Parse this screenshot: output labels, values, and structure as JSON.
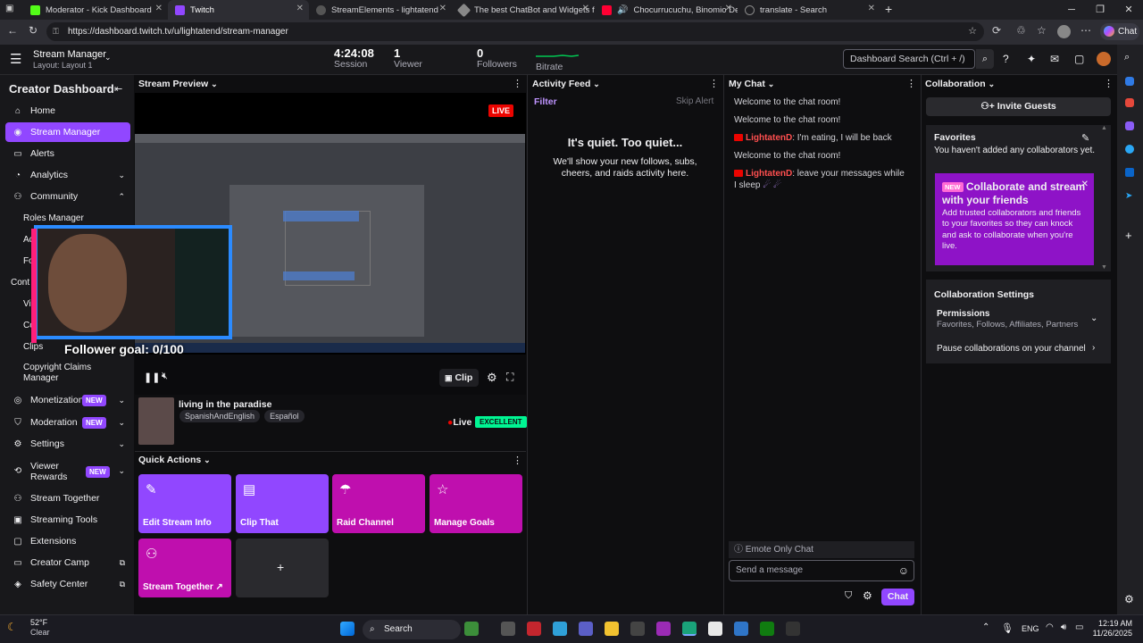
{
  "browser": {
    "tabs": [
      {
        "title": "Moderator - Kick Dashboard"
      },
      {
        "title": "Twitch"
      },
      {
        "title": "StreamElements - lightatend"
      },
      {
        "title": "The best ChatBot and Widgets fo"
      },
      {
        "title": "Chocurrucuchu, Binomio De"
      },
      {
        "title": "translate - Search"
      }
    ],
    "url": "https://dashboard.twitch.tv/u/lightatend/stream-manager"
  },
  "topbar": {
    "title": "Stream Manager",
    "layout": "Layout: Layout 1",
    "session_value": "4:24:08",
    "session_label": "Session",
    "viewer_value": "1",
    "viewer_label": "Viewer",
    "followers_value": "0",
    "followers_label": "Followers",
    "bitrate_label": "Bitrate",
    "search_placeholder": "Dashboard Search (Ctrl + /)"
  },
  "sidebar": {
    "title": "Creator Dashboard",
    "items": [
      {
        "label": "Home",
        "icon": "home-icon"
      },
      {
        "label": "Stream Manager",
        "icon": "broadcast-icon"
      },
      {
        "label": "Alerts",
        "icon": "alert-icon"
      },
      {
        "label": "Analytics",
        "icon": "chart-icon"
      },
      {
        "label": "Community",
        "icon": "community-icon"
      }
    ],
    "community_sub": [
      "Roles Manager",
      "Acti",
      "Follo",
      "Cont",
      "Vide",
      "Colle",
      "Clips",
      "Copyright Claims",
      "Manager"
    ],
    "items2": [
      {
        "label": "Monetization",
        "badge": "NEW"
      },
      {
        "label": "Moderation",
        "badge": "NEW"
      },
      {
        "label": "Settings"
      },
      {
        "label": "Viewer",
        "label2": "Rewards",
        "badge": "NEW"
      },
      {
        "label": "Stream Together"
      },
      {
        "label": "Streaming Tools"
      },
      {
        "label": "Extensions"
      },
      {
        "label": "Creator Camp"
      },
      {
        "label": "Safety Center"
      }
    ]
  },
  "preview": {
    "header": "Stream Preview",
    "live_badge": "LIVE",
    "overlay_text": "Follower goal: 0/100",
    "clip_label": "Clip",
    "stream_title": "living in the paradise",
    "tags": [
      "SpanishAndEnglish",
      "Español"
    ],
    "live_text": "Live",
    "health": "EXCELLENT"
  },
  "quick_actions": {
    "header": "Quick Actions",
    "items": [
      {
        "label": "Edit Stream Info",
        "color": "#9147ff"
      },
      {
        "label": "Clip That",
        "color": "#9147ff"
      },
      {
        "label": "Raid Channel",
        "color": "#bf0fae"
      },
      {
        "label": "Manage Goals",
        "color": "#bf0fae"
      },
      {
        "label": "Stream Together ↗",
        "color": "#bf0fae"
      }
    ],
    "add_label": "+"
  },
  "activity": {
    "header": "Activity Feed",
    "filter": "Filter",
    "skip": "Skip Alert",
    "empty_title": "It's quiet. Too quiet...",
    "empty_body": "We'll show your new follows, subs, cheers, and raids activity here."
  },
  "chat": {
    "header": "My Chat",
    "messages": [
      {
        "text": "Welcome to the chat room!"
      },
      {
        "text": "Welcome to the chat room!"
      },
      {
        "name": "LightatenD",
        "text": ": I'm eating, I will be back"
      },
      {
        "text": "Welcome to the chat room!"
      },
      {
        "name": "LightatenD",
        "text": ": leave your messages while I sleep"
      }
    ],
    "emote_only": "Emote Only Chat",
    "input_placeholder": "Send a message",
    "send_label": "Chat"
  },
  "collab": {
    "header": "Collaboration",
    "invite": "Invite Guests",
    "fav_title": "Favorites",
    "fav_empty": "You haven't added any collaborators yet.",
    "promo_badge": "NEW",
    "promo_title": "Collaborate and stream with your friends",
    "promo_body": "Add trusted collaborators and friends to your favorites so they can knock and ask to collaborate when you're live.",
    "settings_title": "Collaboration Settings",
    "permissions": "Permissions",
    "permissions_detail": "Favorites, Follows, Affiliates, Partners",
    "pause": "Pause collaborations on your channel"
  },
  "taskbar": {
    "weather_temp": "52°F",
    "weather_desc": "Clear",
    "search": "Search",
    "lang": "ENG",
    "time": "12:19 AM",
    "date": "11/26/2025"
  }
}
